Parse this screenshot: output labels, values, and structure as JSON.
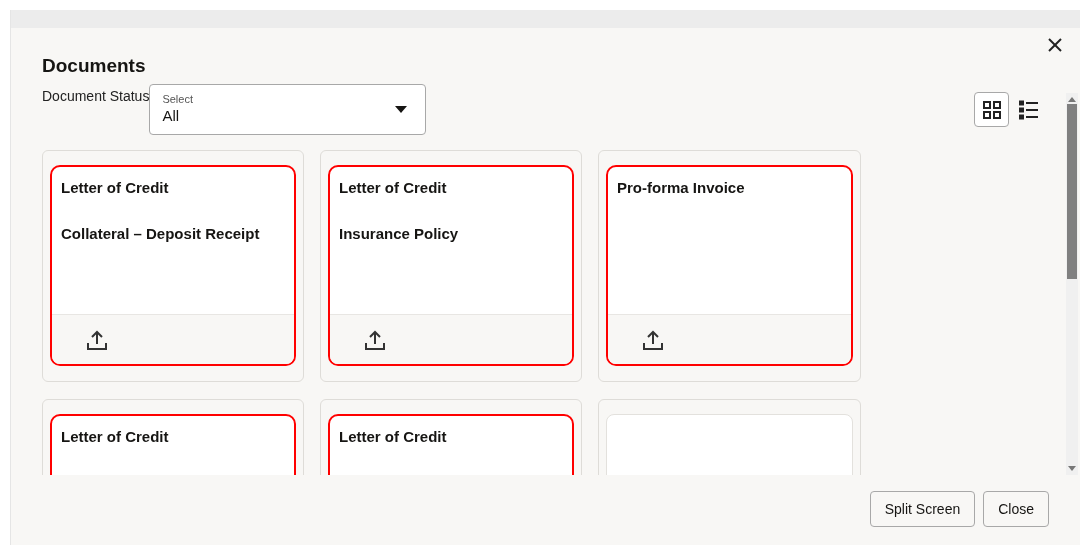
{
  "dialog": {
    "title": "Documents"
  },
  "filter": {
    "label": "Document Status",
    "placeholder": "Select",
    "value": "All"
  },
  "views": [
    {
      "kind": "grid",
      "selected": true
    },
    {
      "kind": "list",
      "selected": false
    }
  ],
  "cards": [
    {
      "lines": [
        "Letter of Credit",
        "Collateral – Deposit Receipt"
      ],
      "highlighted": true
    },
    {
      "lines": [
        "Letter of Credit",
        "Insurance Policy"
      ],
      "highlighted": true
    },
    {
      "lines": [
        "Pro-forma Invoice"
      ],
      "highlighted": true
    },
    {
      "lines": [
        "Letter of Credit"
      ],
      "highlighted": true
    },
    {
      "lines": [
        "Letter of Credit"
      ],
      "highlighted": true
    },
    {
      "highlighted": false
    }
  ],
  "buttons": [
    "Split Screen",
    "Close"
  ]
}
